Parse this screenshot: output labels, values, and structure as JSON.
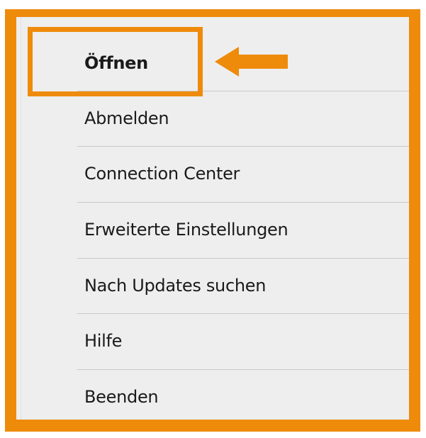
{
  "menu": {
    "items": [
      {
        "label": "Öffnen"
      },
      {
        "label": "Abmelden"
      },
      {
        "label": "Connection Center"
      },
      {
        "label": "Erweiterte Einstellungen"
      },
      {
        "label": "Nach Updates suchen"
      },
      {
        "label": "Hilfe"
      },
      {
        "label": "Beenden"
      }
    ]
  },
  "annotation": {
    "color": "#ee8b0a",
    "target": "Öffnen",
    "arrow": "left-arrow-icon"
  }
}
